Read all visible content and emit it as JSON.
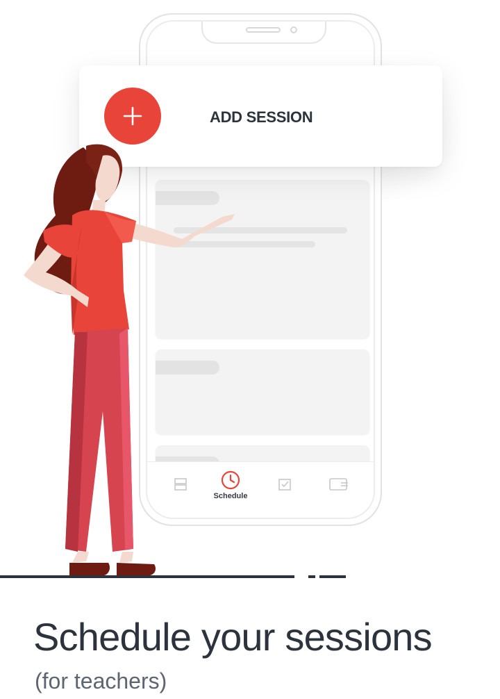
{
  "add_session": {
    "label": "ADD SESSION",
    "icon": "plus-icon"
  },
  "tabbar": {
    "active_label": "Schedule",
    "tabs": [
      {
        "icon": "list-icon"
      },
      {
        "icon": "clock-icon",
        "label": "Schedule",
        "active": true
      },
      {
        "icon": "checkbox-icon"
      },
      {
        "icon": "wallet-icon"
      }
    ]
  },
  "headline": {
    "title": "Schedule your sessions",
    "subtitle": "(for teachers)"
  },
  "colors": {
    "accent": "#e8443a",
    "text_dark": "#2c333d",
    "placeholder": "#f3f3f3",
    "pants": "#d5444f",
    "hair": "#6e1c12"
  }
}
